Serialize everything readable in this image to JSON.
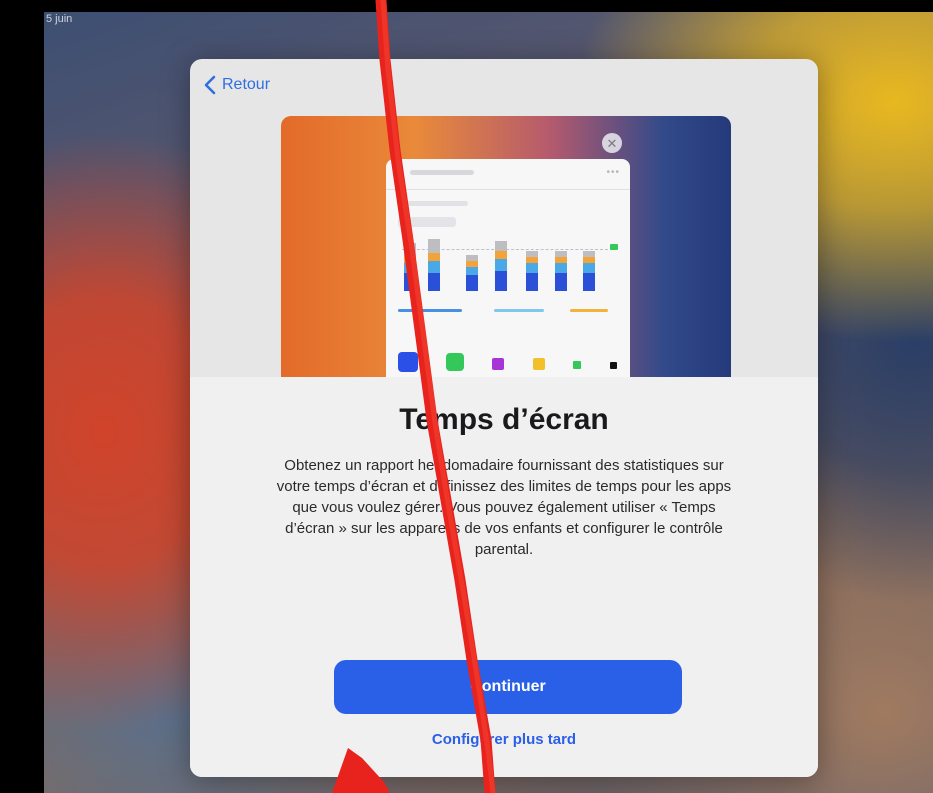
{
  "status_bar": {
    "date_text": "5 juin"
  },
  "navigation": {
    "back_label": "Retour"
  },
  "onboarding": {
    "title": "Temps d’écran",
    "description": "Obtenez un rapport hebdomadaire fournissant des statistiques sur votre temps d’écran et définissez des limites de temps pour les apps que vous voulez gérer. Vous pouvez également utiliser « Temps d’écran » sur les appareils de vos enfants et configurer le contrôle parental.",
    "continue_label": "Continuer",
    "later_label": "Configurer plus tard"
  },
  "colors": {
    "accent": "#2a5fe8",
    "back_link": "#2f6fe0",
    "sheet_top": "#e7e6e7",
    "sheet_bottom": "#f1f0f1"
  },
  "icons": {
    "back": "chevron-left-icon",
    "close": "close-icon",
    "annotation": "red-marker-annotation"
  }
}
